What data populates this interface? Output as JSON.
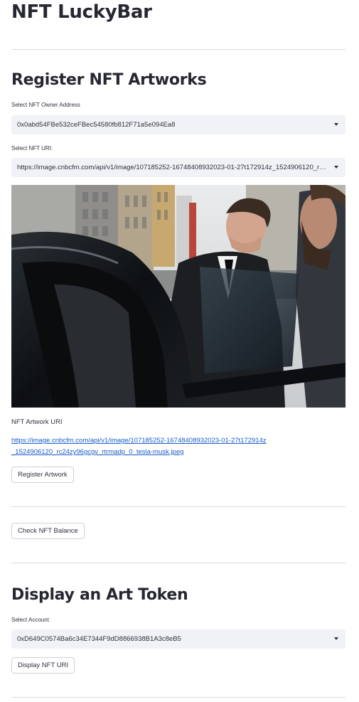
{
  "app": {
    "title": "NFT LuckyBar"
  },
  "register": {
    "heading": "Register NFT Artworks",
    "owner_label": "Select NFT Owner Address",
    "owner_value": "0x0abd54FBe532ceFBec54580fb812F71a5e094Ea8",
    "uri_label": "Select NFT URI:",
    "uri_value": "https://image.cnbcfm.com/api/v1/image/107185252-16748408932023-01-27t172914z_1524906120_rc24zy96gcgv_rtrmadp_0_tesla-musk.jpeg",
    "caption": "NFT Artwork URI",
    "link_text": "https://image.cnbcfm.com/api/v1/image/107185252-16748408932023-01-27t172914z_1524906120_rc24zy96gcgv_rtrmadp_0_tesla-musk.jpeg",
    "register_button": "Register Artwork"
  },
  "balance": {
    "button": "Check NFT Balance"
  },
  "display": {
    "heading": "Display an Art Token",
    "account_label": "Select Account",
    "account_value": "0xD649C0574Ba6c34E7344F9dD8866938B1A3c8eB5",
    "button": "Display NFT URI"
  },
  "icons": {
    "select_caret": "chevron-down-icon"
  }
}
